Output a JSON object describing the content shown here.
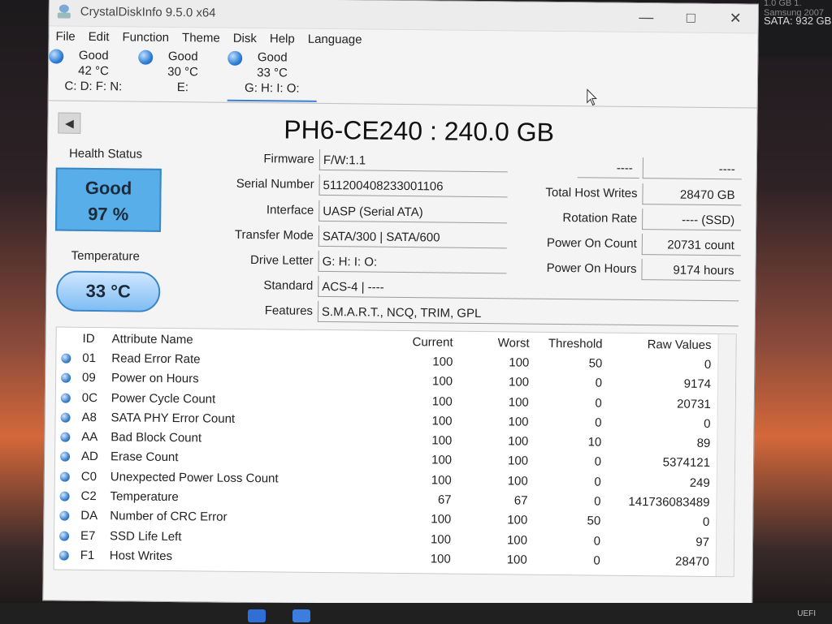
{
  "desktop": {
    "top_right_faint": "1.0 GB   1. Samsung 2007",
    "top_right_text": "SATA: 932 GB",
    "tray_text": "UEFI"
  },
  "window": {
    "title": "CrystalDiskInfo 9.5.0 x64",
    "minimize": "—",
    "maximize": "□",
    "close": "✕"
  },
  "menu": [
    "File",
    "Edit",
    "Function",
    "Theme",
    "Disk",
    "Help",
    "Language"
  ],
  "disks": [
    {
      "status": "Good",
      "temp": "42 °C",
      "letters": "C: D: F: N:"
    },
    {
      "status": "Good",
      "temp": "30 °C",
      "letters": "E:"
    },
    {
      "status": "Good",
      "temp": "33 °C",
      "letters": "G: H: I: O:"
    }
  ],
  "drive": {
    "model": "PH6-CE240 : 240.0 GB",
    "health_label": "Health Status",
    "health_status": "Good",
    "health_percent": "97 %",
    "temperature_label": "Temperature",
    "temperature": "33 °C",
    "labels": {
      "firmware": "Firmware",
      "serial": "Serial Number",
      "interface": "Interface",
      "transfer": "Transfer Mode",
      "letter": "Drive Letter",
      "standard": "Standard",
      "features": "Features",
      "host_writes": "Total Host Writes",
      "rotation": "Rotation Rate",
      "power_count": "Power On Count",
      "power_hours": "Power On Hours"
    },
    "values": {
      "firmware": "F/W:1.1",
      "serial": "511200408233001106",
      "interface": "UASP (Serial ATA)",
      "transfer": "SATA/300 | SATA/600",
      "letter": "G: H: I: O:",
      "standard": "ACS-4 | ----",
      "features": "S.M.A.R.T., NCQ, TRIM, GPL",
      "top_left": "----",
      "top_right": "----",
      "host_writes": "28470 GB",
      "rotation": "---- (SSD)",
      "power_count": "20731 count",
      "power_hours": "9174 hours"
    }
  },
  "smart": {
    "headers": {
      "id": "ID",
      "name": "Attribute Name",
      "current": "Current",
      "worst": "Worst",
      "threshold": "Threshold",
      "raw": "Raw Values"
    },
    "rows": [
      {
        "id": "01",
        "name": "Read Error Rate",
        "current": "100",
        "worst": "100",
        "threshold": "50",
        "raw": "0"
      },
      {
        "id": "09",
        "name": "Power on Hours",
        "current": "100",
        "worst": "100",
        "threshold": "0",
        "raw": "9174"
      },
      {
        "id": "0C",
        "name": "Power Cycle Count",
        "current": "100",
        "worst": "100",
        "threshold": "0",
        "raw": "20731"
      },
      {
        "id": "A8",
        "name": "SATA PHY Error Count",
        "current": "100",
        "worst": "100",
        "threshold": "0",
        "raw": "0"
      },
      {
        "id": "AA",
        "name": "Bad Block Count",
        "current": "100",
        "worst": "100",
        "threshold": "10",
        "raw": "89"
      },
      {
        "id": "AD",
        "name": "Erase Count",
        "current": "100",
        "worst": "100",
        "threshold": "0",
        "raw": "5374121"
      },
      {
        "id": "C0",
        "name": "Unexpected Power Loss Count",
        "current": "100",
        "worst": "100",
        "threshold": "0",
        "raw": "249"
      },
      {
        "id": "C2",
        "name": "Temperature",
        "current": "67",
        "worst": "67",
        "threshold": "0",
        "raw": "141736083489"
      },
      {
        "id": "DA",
        "name": "Number of CRC Error",
        "current": "100",
        "worst": "100",
        "threshold": "50",
        "raw": "0"
      },
      {
        "id": "E7",
        "name": "SSD Life Left",
        "current": "100",
        "worst": "100",
        "threshold": "0",
        "raw": "97"
      },
      {
        "id": "F1",
        "name": "Host Writes",
        "current": "100",
        "worst": "100",
        "threshold": "0",
        "raw": "28470"
      }
    ]
  },
  "colors": {
    "health_box": "#58aee9",
    "status_dot": "#2d7cd6"
  }
}
